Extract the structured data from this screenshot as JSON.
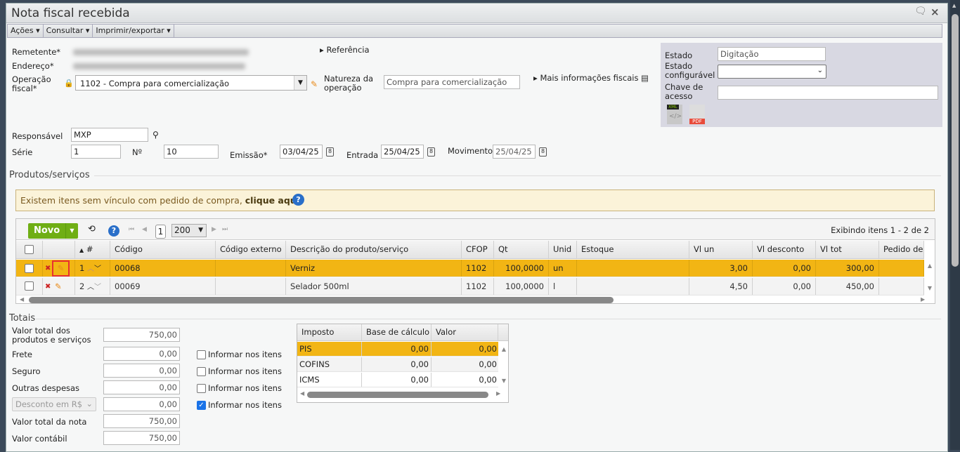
{
  "window": {
    "title": "Nota fiscal recebida"
  },
  "menu": [
    "Ações",
    "Consultar",
    "Imprimir/exportar"
  ],
  "form": {
    "remetente_label": "Remetente*",
    "endereco_label": "Endereço*",
    "operacao_label": "Operação fiscal*",
    "operacao_value": "1102 - Compra para comercialização",
    "natureza_label": "Natureza da operação",
    "natureza_value": "Compra para comercialização",
    "referencia": "Referência",
    "mais_info": "Mais informações fiscais",
    "responsavel_label": "Responsável",
    "responsavel_value": "MXP",
    "serie_label": "Série",
    "serie_value": "1",
    "numero_label": "Nº",
    "numero_value": "10",
    "emissao_label": "Emissão*",
    "emissao_value": "03/04/25",
    "entrada_label": "Entrada",
    "entrada_value": "25/04/25",
    "movimento_label": "Movimento",
    "movimento_value": "25/04/25",
    "calendar_glyph": "8"
  },
  "estado": {
    "estado_label": "Estado",
    "estado_value": "Digitação",
    "config_label": "Estado configurável",
    "chave_label": "Chave de acesso",
    "xml": "XML",
    "pdf": "PDF"
  },
  "produtos": {
    "section": "Produtos/serviços",
    "warning_text": "Existem itens sem vínculo com pedido de compra, ",
    "warning_link": "clique aqui",
    "novo": "Novo",
    "page": "1",
    "page_size": "200",
    "exibindo": "Exibindo itens 1 - 2 de 2",
    "columns": [
      "#",
      "Código",
      "Código externo",
      "Descrição do produto/serviço",
      "CFOP",
      "Qt",
      "Unid",
      "Estoque",
      "Vl un",
      "Vl desconto",
      "Vl tot",
      "Pedido de"
    ],
    "rows": [
      {
        "n": "1",
        "codigo": "00068",
        "externo": "",
        "descricao": "Verniz",
        "cfop": "1102",
        "qt": "100,0000",
        "unid": "un",
        "estoque": "",
        "vlun": "3,00",
        "vldesc": "0,00",
        "vltot": "300,00",
        "pedido": ""
      },
      {
        "n": "2",
        "codigo": "00069",
        "externo": "",
        "descricao": "Selador 500ml",
        "cfop": "1102",
        "qt": "100,0000",
        "unid": "l",
        "estoque": "",
        "vlun": "4,50",
        "vldesc": "0,00",
        "vltot": "450,00",
        "pedido": ""
      }
    ]
  },
  "totais": {
    "section": "Totais",
    "valor_produtos_label": "Valor total dos produtos e serviços",
    "valor_produtos": "750,00",
    "frete_label": "Frete",
    "frete": "0,00",
    "seguro_label": "Seguro",
    "seguro": "0,00",
    "outras_label": "Outras despesas",
    "outras": "0,00",
    "desconto_select": "Desconto em R$",
    "desconto": "0,00",
    "total_nota_label": "Valor total da nota",
    "total_nota": "750,00",
    "contabil_label": "Valor contábil",
    "contabil": "750,00",
    "informar": "Informar nos itens"
  },
  "impostos": {
    "columns": [
      "Imposto",
      "Base de cálculo",
      "Valor"
    ],
    "rows": [
      {
        "imposto": "PIS",
        "base": "0,00",
        "valor": "0,00"
      },
      {
        "imposto": "COFINS",
        "base": "0,00",
        "valor": "0,00"
      },
      {
        "imposto": "ICMS",
        "base": "0,00",
        "valor": "0,00"
      }
    ]
  },
  "colors": {
    "highlight": "#f2b514",
    "novo": "#6fae14",
    "warning_bg": "#fbf3d9"
  }
}
